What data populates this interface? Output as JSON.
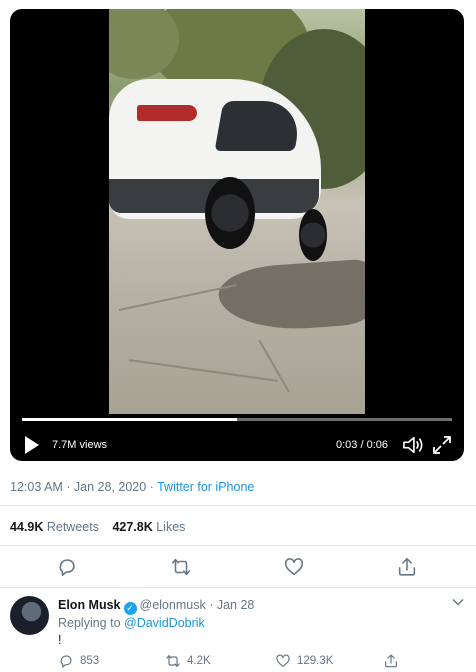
{
  "video": {
    "views": "7.7M views",
    "time": "0:03 / 0:06",
    "progress_fraction": 0.5
  },
  "tweet": {
    "timestamp": "12:03 AM · Jan 28, 2020 · ",
    "source": "Twitter for iPhone",
    "retweets_count": "44.9K",
    "retweets_label": "Retweets",
    "likes_count": "427.8K",
    "likes_label": "Likes"
  },
  "icons": {
    "play": "play-icon",
    "volume": "volume-icon",
    "fullscreen": "expand-icon",
    "reply": "reply-icon",
    "retweet": "retweet-icon",
    "like": "heart-icon",
    "share": "share-icon",
    "verified": "verified-badge-icon",
    "more": "chevron-down-icon"
  },
  "reply": {
    "name": "Elon Musk",
    "handle": "@elonmusk",
    "separator": "·",
    "date": "Jan 28",
    "replying_prefix": "Replying to ",
    "replying_to": "@DavidDobrik",
    "text": "!",
    "reply_count": "853",
    "retweet_count": "4.2K",
    "like_count": "129.3K"
  },
  "colors": {
    "accent": "#1b95e0",
    "muted": "#657786",
    "text": "#14171a",
    "divider": "#e1e8ed"
  }
}
